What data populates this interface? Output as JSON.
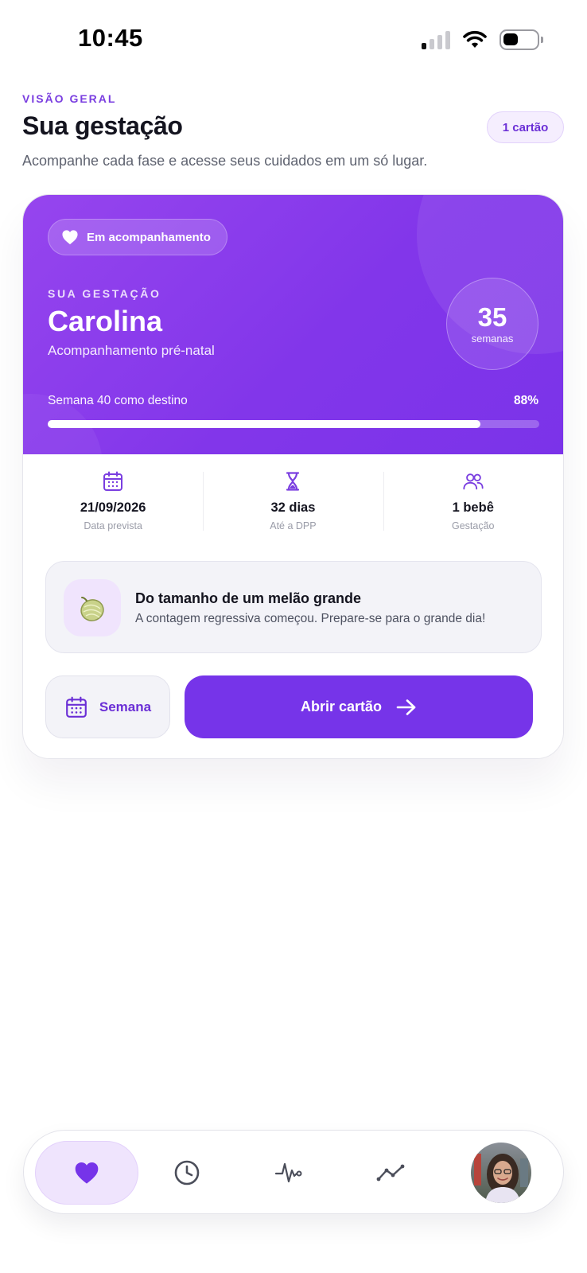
{
  "status_bar": {
    "time": "10:45"
  },
  "header": {
    "eyebrow": "VISÃO GERAL",
    "title": "Sua gestação",
    "count_chip": "1 cartão",
    "subtitle": "Acompanhe cada fase e acesse seus cuidados em um só lugar."
  },
  "card": {
    "status_pill": "Em acompanhamento",
    "eyebrow": "SUA GESTAÇÃO",
    "name": "Carolina",
    "subtitle": "Acompanhamento pré-natal",
    "week_number": "35",
    "week_label": "semanas",
    "progress_label": "Semana 40 como destino",
    "progress_percent_text": "88%",
    "progress_value": 0.88,
    "stats": [
      {
        "icon": "calendar-icon",
        "value": "21/09/2026",
        "label": "Data prevista"
      },
      {
        "icon": "hourglass-icon",
        "value": "32 dias",
        "label": "Até a DPP"
      },
      {
        "icon": "users-icon",
        "value": "1 bebê",
        "label": "Gestação"
      }
    ],
    "tip": {
      "icon": "melon-icon",
      "title": "Do tamanho de um melão grande",
      "text": "A contagem regressiva começou. Prepare-se para o grande dia!"
    },
    "week_button": "Semana",
    "open_button": "Abrir cartão"
  },
  "bottom_nav": {
    "items": [
      "heart-icon",
      "clock-icon",
      "pulse-icon",
      "trend-icon",
      "avatar"
    ],
    "active": "heart-icon"
  },
  "colors": {
    "accent": "#7634e9",
    "hero_gradient_start": "#9645ee",
    "hero_gradient_end": "#7b33e9",
    "chip_bg": "#f5eefe",
    "tip_bg": "#f3f3f8"
  }
}
